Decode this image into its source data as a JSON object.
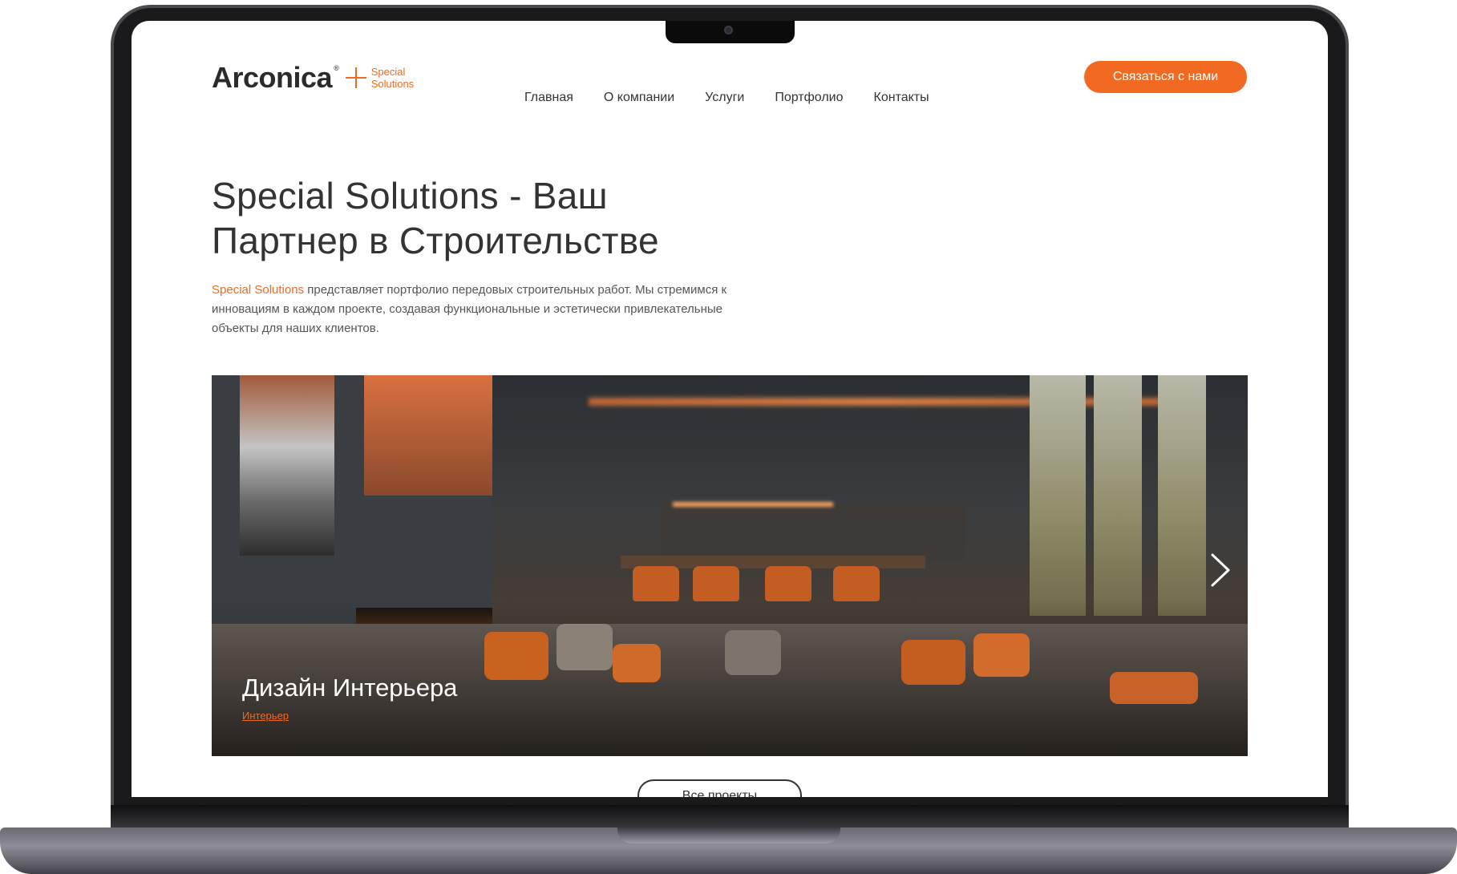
{
  "header": {
    "logo": {
      "main": "Arconica",
      "reg": "®",
      "sub_line1": "Special",
      "sub_line2": "Solutions"
    },
    "nav": [
      {
        "label": "Главная"
      },
      {
        "label": "О компании"
      },
      {
        "label": "Услуги"
      },
      {
        "label": "Портфолио"
      },
      {
        "label": "Контакты"
      }
    ],
    "cta_label": "Связаться с нами"
  },
  "hero": {
    "title_line1": "Special Solutions - Ваш",
    "title_line2": "Партнер в Строительстве",
    "text_accent": "Special Solutions",
    "text_rest": " представляет портфолио передовых строительных работ. Мы стремимся к инновациям в каждом проекте, создавая функциональные и эстетически привлекательные объекты для наших клиентов."
  },
  "slider": {
    "slide_title": "Дизайн Интерьера",
    "slide_tag": "Интерьер",
    "next_icon": "chevron-right-icon"
  },
  "all_projects_label": "Все проекты",
  "colors": {
    "accent": "#f26a21",
    "text": "#333333"
  }
}
